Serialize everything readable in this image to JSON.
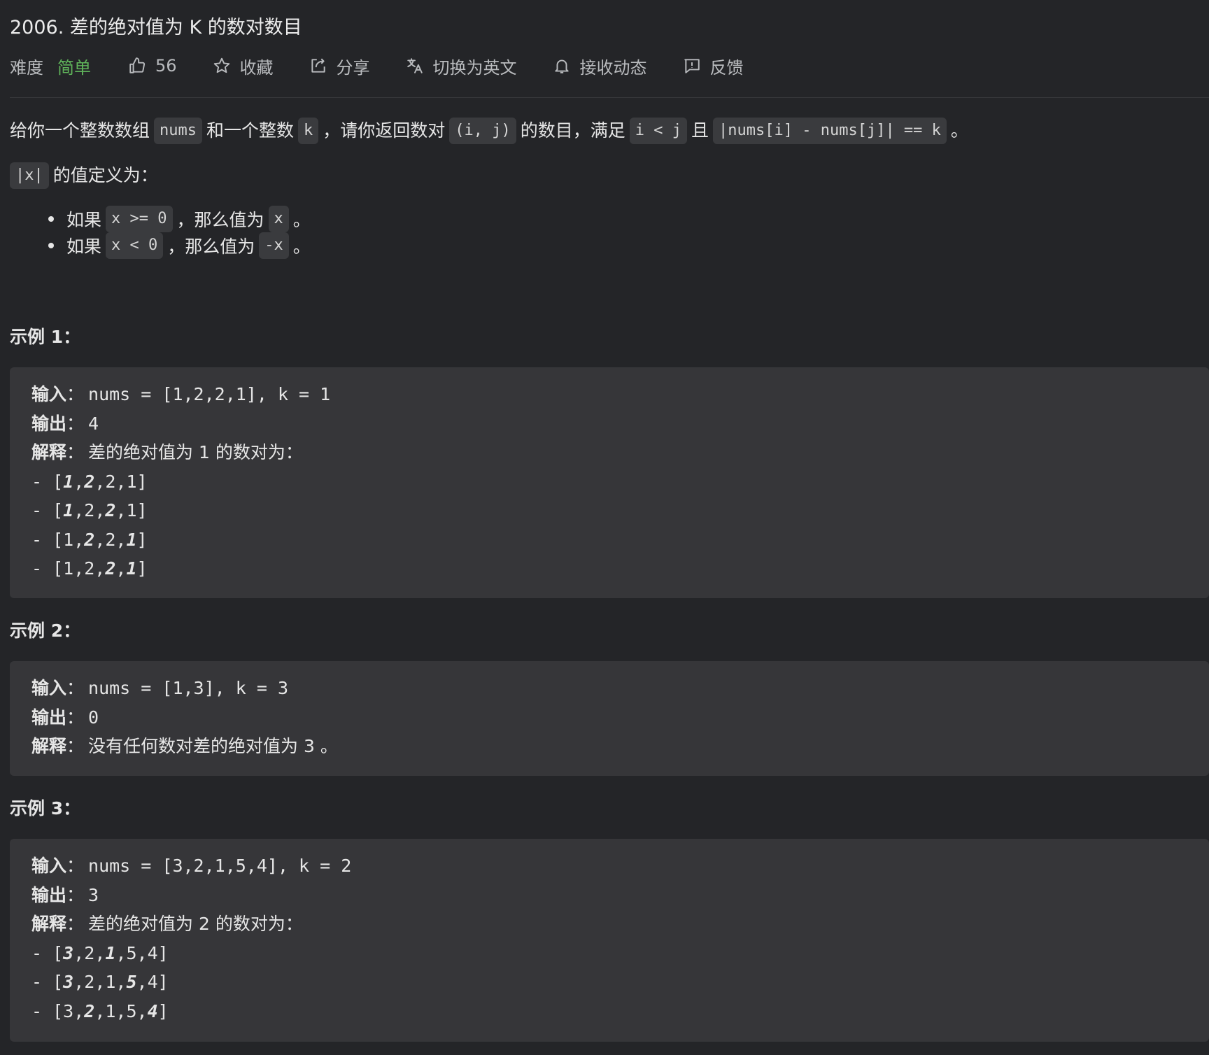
{
  "title": "2006. 差的绝对值为 K 的数对数目",
  "toolbar": {
    "difficulty_label": "难度",
    "difficulty_value": "简单",
    "likes": "56",
    "favorite": "收藏",
    "share": "分享",
    "switch_lang": "切换为英文",
    "subscribe": "接收动态",
    "feedback": "反馈",
    "icons": [
      "thumbs-up-icon",
      "star-icon",
      "share-icon",
      "translate-icon",
      "bell-icon",
      "feedback-icon"
    ],
    "colors": {
      "difficulty_easy": "#5fb35a"
    }
  },
  "description": {
    "p1": {
      "t1": "给你一个整数数组",
      "c1": "nums",
      "t2": "和一个整数",
      "c2": "k",
      "t3": "，请你返回数对",
      "c3": "(i, j)",
      "t4": "的数目，满足",
      "c4": "i < j",
      "t5": "且",
      "c5": "|nums[i] - nums[j]| == k",
      "t6": "。"
    },
    "p2": {
      "c1": "|x|",
      "t1": "的值定义为："
    },
    "bullets": [
      {
        "t1": "如果",
        "c1": "x >= 0",
        "t2": "，那么值为",
        "c2": "x",
        "t3": "。"
      },
      {
        "t1": "如果",
        "c1": "x < 0",
        "t2": "，那么值为",
        "c2": "-x",
        "t3": "。"
      }
    ]
  },
  "examples": [
    {
      "title": "示例 1：",
      "input_label": "输入",
      "input": "nums = [1,2,2,1], k = 1",
      "output_label": "输出",
      "output": "4",
      "explain_label": "解释",
      "explain": "差的绝对值为 1 的数对为：",
      "pairs": [
        [
          "- [",
          "1",
          ",",
          "2",
          ",2,1]"
        ],
        [
          "- [",
          "1",
          ",2,",
          "2",
          ",1]"
        ],
        [
          "- [1,",
          "2",
          ",2,",
          "1",
          "]"
        ],
        [
          "- [1,2,",
          "2",
          ",",
          "1",
          "]"
        ]
      ]
    },
    {
      "title": "示例 2：",
      "input_label": "输入",
      "input": "nums = [1,3], k = 3",
      "output_label": "输出",
      "output": "0",
      "explain_label": "解释",
      "explain": "没有任何数对差的绝对值为 3 。"
    },
    {
      "title": "示例 3：",
      "input_label": "输入",
      "input": "nums = [3,2,1,5,4], k = 2",
      "output_label": "输出",
      "output": "3",
      "explain_label": "解释",
      "explain": "差的绝对值为 2 的数对为：",
      "pairs": [
        [
          "- [",
          "3",
          ",2,",
          "1",
          ",5,4]"
        ],
        [
          "- [",
          "3",
          ",2,1,",
          "5",
          ",4]"
        ],
        [
          "- [3,",
          "2",
          ",1,5,",
          "4",
          "]"
        ]
      ]
    }
  ]
}
